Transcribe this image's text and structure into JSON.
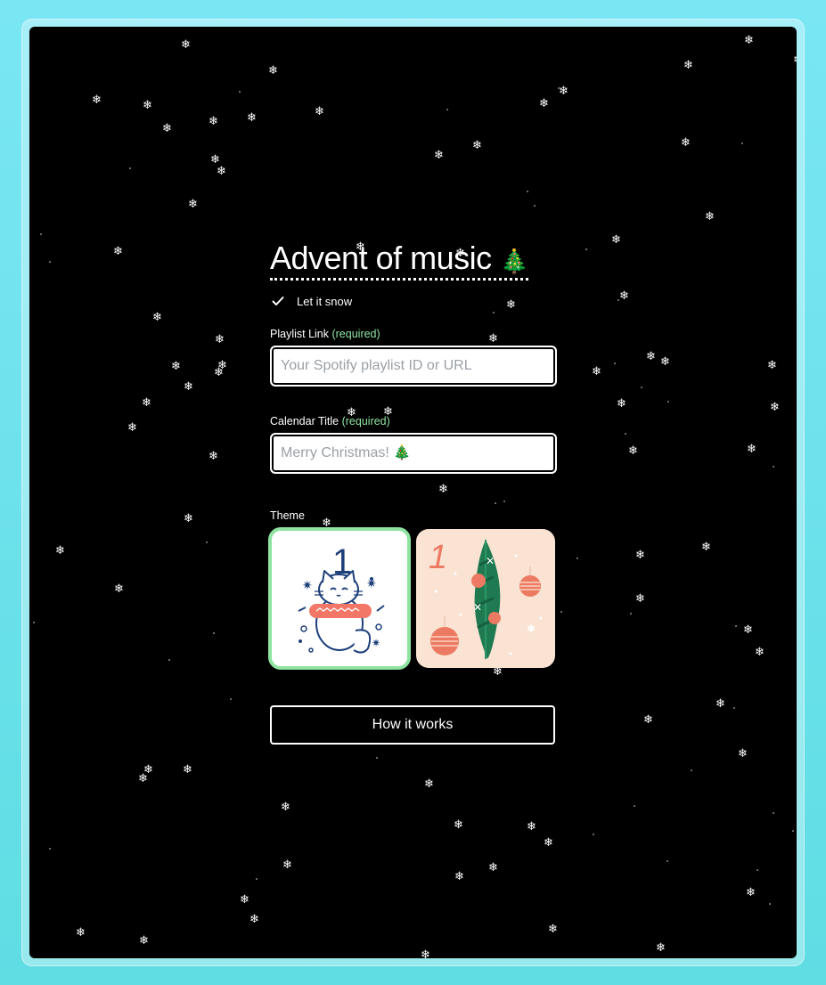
{
  "app": {
    "title": "Advent of music",
    "title_emoji": "🎄"
  },
  "snow_toggle": {
    "label": "Let it snow",
    "checked": true,
    "icon": "check-icon"
  },
  "playlist": {
    "label": "Playlist Link",
    "required_text": "(required)",
    "placeholder": "Your Spotify playlist ID or URL",
    "value": ""
  },
  "calendar_title": {
    "label": "Calendar Title",
    "required_text": "(required)",
    "placeholder": "Merry Christmas! 🎄",
    "value": ""
  },
  "theme": {
    "label": "Theme",
    "options": [
      {
        "name": "cat",
        "day_number": "1",
        "selected": true
      },
      {
        "name": "christmas-tree",
        "day_number": "1",
        "selected": false
      }
    ]
  },
  "how_button": {
    "label": "How it works"
  },
  "colors": {
    "background_gradient_top": "#7ae6f4",
    "background_gradient_bottom": "#5fdde3",
    "panel": "#000000",
    "required_accent": "#8fe3a1",
    "selected_theme_border": "#8fe3a1",
    "tree_theme_bg": "#fbe3d3"
  },
  "snowflake_glyph": "❄"
}
